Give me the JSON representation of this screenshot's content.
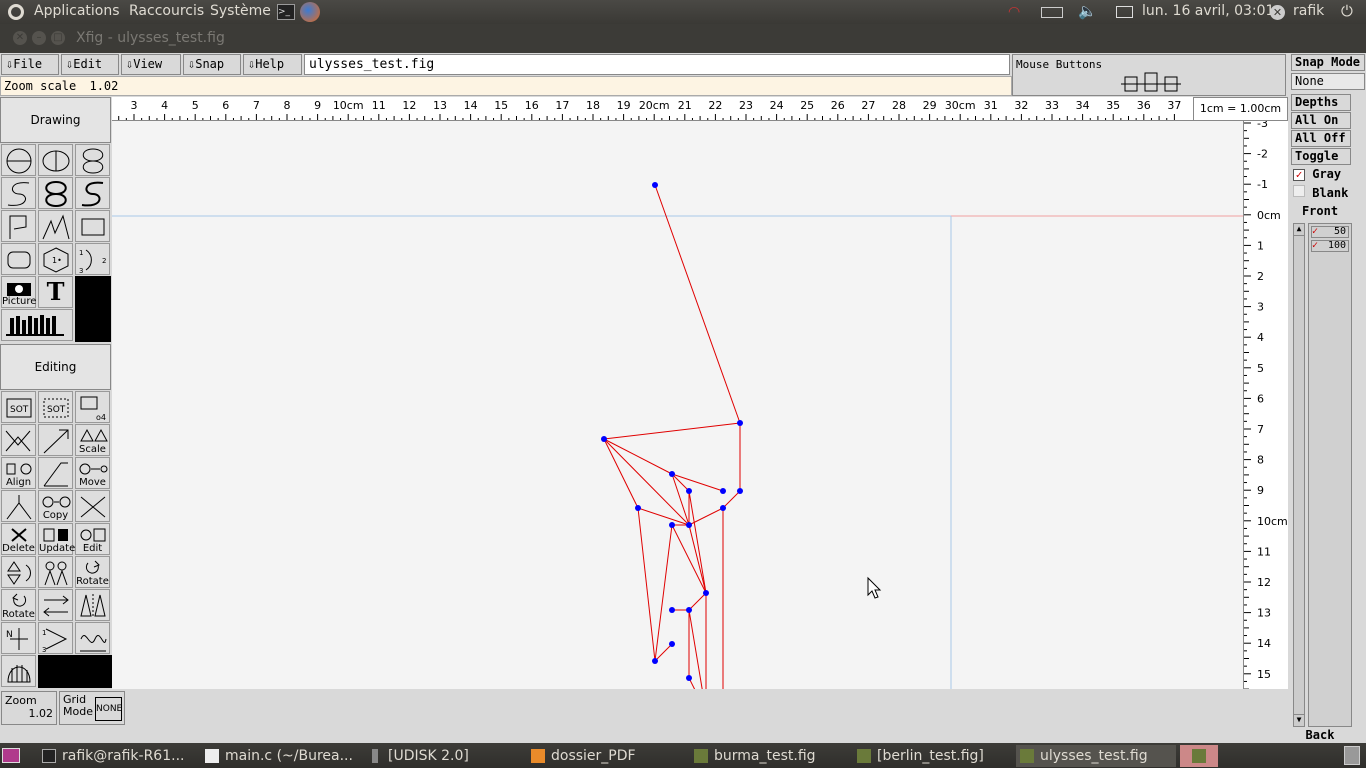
{
  "panel": {
    "menus": [
      "Applications",
      "Raccourcis",
      "Système"
    ],
    "clock": "lun. 16 avril, 03:01",
    "user": "rafik"
  },
  "window": {
    "title": "Xfig - ulysses_test.fig"
  },
  "xfig": {
    "menus": [
      "File",
      "Edit",
      "View",
      "Snap",
      "Help"
    ],
    "filename": "ulysses_test.fig",
    "mouse_buttons_label": "Mouse Buttons",
    "zoom_scale_label": "Zoom scale",
    "zoom_scale_value": "1.02",
    "unit_label": "1cm = 1.00cm",
    "drawing_label": "Drawing",
    "editing_label": "Editing",
    "drawing_tool_labels": {
      "picture": "Picture"
    },
    "editing_tool_labels": {
      "scale": "Scale",
      "align": "Align",
      "move": "Move",
      "copy": "Copy",
      "delete": "Delete",
      "update": "Update",
      "edit": "Edit",
      "rotate_ccw": "Rotate",
      "rotate_cw": "Rotate"
    },
    "zoom_label": "Zoom",
    "zoom_value": "1.02",
    "grid_mode_label": "Grid\nMode",
    "grid_mode_value": "NONE",
    "ruler_top": [
      "3",
      "4",
      "5",
      "6",
      "7",
      "8",
      "9",
      "10cm",
      "11",
      "12",
      "13",
      "14",
      "15",
      "16",
      "17",
      "18",
      "19",
      "20cm",
      "21",
      "22",
      "23",
      "24",
      "25",
      "26",
      "27",
      "28",
      "29",
      "30cm",
      "31",
      "32",
      "33",
      "34",
      "35",
      "36",
      "37"
    ],
    "ruler_right": [
      "-3",
      "-2",
      "-1",
      "0cm",
      "1",
      "2",
      "3",
      "4",
      "5",
      "6",
      "7",
      "8",
      "9",
      "10cm",
      "11",
      "12",
      "13",
      "14",
      "15"
    ],
    "right": {
      "snap_mode_label": "Snap Mode",
      "snap_mode_value": "None",
      "depths_label": "Depths",
      "all_on": "All On",
      "all_off": "All Off",
      "toggle": "Toggle",
      "gray_label": "Gray",
      "blank_label": "Blank",
      "front_label": "Front",
      "back_label": "Back",
      "depth_items": [
        "50",
        "100"
      ]
    }
  },
  "taskbar": {
    "tasks": [
      "rafik@rafik-R61...",
      "main.c (~/Burea...",
      "[UDISK 2.0]",
      "dossier_PDF",
      "burma_test.fig",
      "[berlin_test.fig]",
      "ulysses_test.fig"
    ]
  },
  "colors": {
    "line": "#e00000",
    "point": "#0000ff",
    "grid": "#a8c8e8"
  }
}
